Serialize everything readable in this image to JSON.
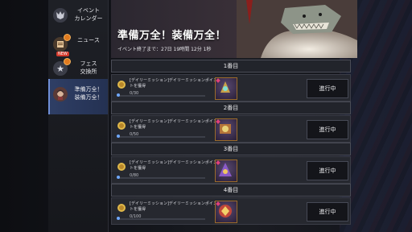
{
  "sidebar": {
    "items": [
      {
        "label": "イベント\nカレンダー",
        "icon": "wolf-emblem-icon",
        "active": false
      },
      {
        "label": "ニュース",
        "icon": "news-icon",
        "active": false,
        "badge": true,
        "tag": "NEW"
      },
      {
        "label": "フェス\n交換所",
        "icon": "star-icon",
        "active": false,
        "badge": true
      },
      {
        "label": "準備万全！\n装備万全！",
        "icon": "hero-portrait-icon",
        "active": true
      }
    ]
  },
  "header": {
    "title": "準備万全！装備万全！",
    "subtitle": "イベント終了まで：27日 19時間 12分 1秒"
  },
  "sections": [
    {
      "heading": "1番目",
      "mission": "[デイリーミッション]デイリーミッションポイントを獲得",
      "progress": "0/30",
      "fraction": 0,
      "status": "進行中"
    },
    {
      "heading": "2番目",
      "mission": "[デイリーミッション]デイリーミッションポイントを獲得",
      "progress": "0/50",
      "fraction": 0,
      "status": "進行中"
    },
    {
      "heading": "3番目",
      "mission": "[デイリーミッション]デイリーミッションポイントを獲得",
      "progress": "0/80",
      "fraction": 0,
      "status": "進行中"
    },
    {
      "heading": "4番目",
      "mission": "[デイリーミッション]デイリーミッションポイントを獲得",
      "progress": "0/100",
      "fraction": 0,
      "status": "進行中"
    }
  ],
  "colors": {
    "accent": "#5da1ff",
    "active_tab": "#2f3f66",
    "badge": "#e07a1f"
  }
}
